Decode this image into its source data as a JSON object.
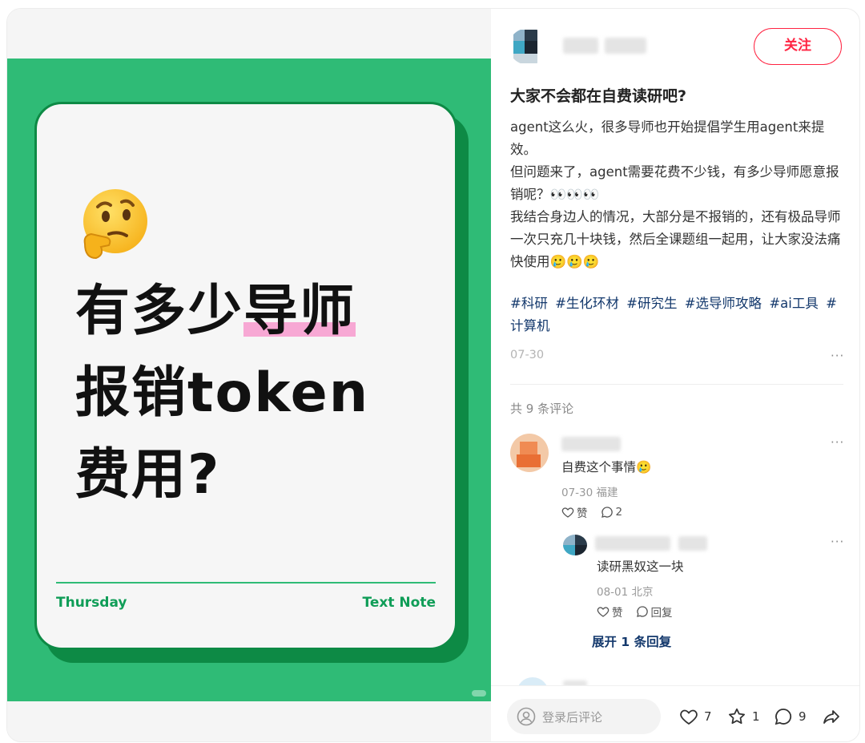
{
  "post": {
    "follow_label": "关注",
    "title": "大家不会都在自费读研吧?",
    "desc_lines": [
      "agent这么火，很多导师也开始提倡学生用agent来提效。",
      "但问题来了，agent需要花费不少钱，有多少导师愿意报销呢？👀👀👀",
      "我结合身边人的情况，大部分是不报销的，还有极品导师一次只充几十块钱，然后全课题组一起用，让大家没法痛快使用🥲🥲🥲"
    ],
    "tags": [
      "#科研",
      "#生化环材",
      "#研究生",
      "#选导师攻略",
      "#ai工具",
      "#计算机"
    ],
    "date": "07-30",
    "more": "···"
  },
  "image": {
    "emoji": "thinking-face",
    "headline_line1_a": "有多少",
    "headline_line1_b": "导师",
    "headline_line2": "报销token",
    "headline_line3": "费用?",
    "footer_left": "Thursday",
    "footer_right": "Text Note"
  },
  "comments": {
    "count_label": "共 9 条评论",
    "first": {
      "text": "自费这个事情🥲",
      "meta": "07-30 福建",
      "like_label": "赞",
      "reply_count": "2"
    },
    "reply": {
      "text": "读研黑奴这一块",
      "meta": "08-01 北京",
      "like_label": "赞",
      "reply_label": "回复"
    },
    "expand_label": "展开 1 条回复"
  },
  "bottom": {
    "comment_placeholder": "登录后评论",
    "likes": "7",
    "stars": "1",
    "comments": "9"
  },
  "colors": {
    "brand": "#ff2442",
    "green": "#2fbb76",
    "tag": "#13386c"
  }
}
